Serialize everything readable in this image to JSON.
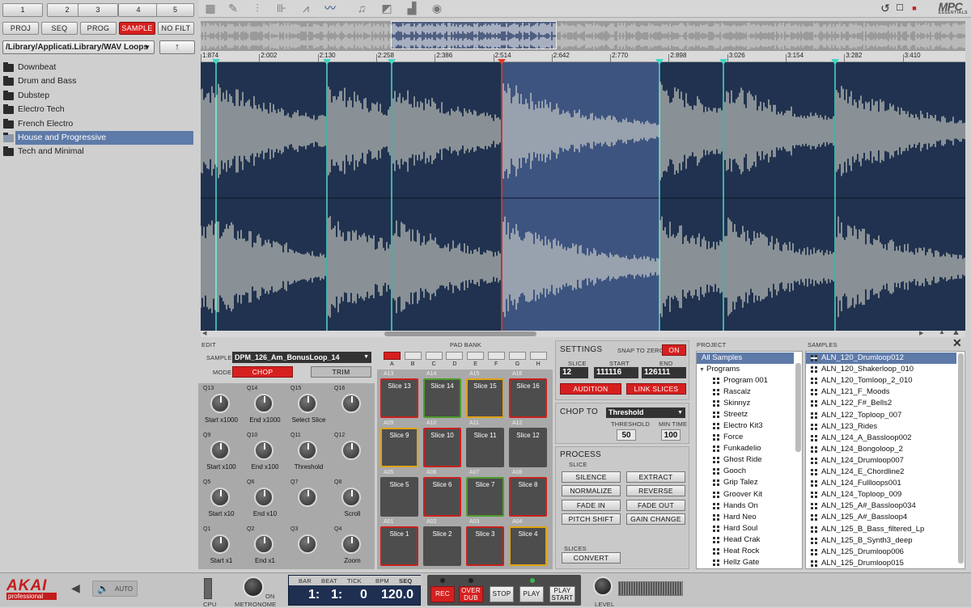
{
  "numbers": [
    "1",
    "2",
    "3",
    "4",
    "5"
  ],
  "modes": [
    {
      "label": "PROJ",
      "active": false
    },
    {
      "label": "SEQ",
      "active": false
    },
    {
      "label": "PROG",
      "active": false
    },
    {
      "label": "SAMPLE",
      "active": true
    },
    {
      "label": "NO FILT",
      "active": false
    }
  ],
  "path": "/Library/Applicati.Library/WAV Loops",
  "up_icon": "↑",
  "folders": [
    "Downbeat",
    "Drum and Bass",
    "Dubstep",
    "Electro Tech",
    "French Electro",
    "House and Progressive",
    "Tech and Minimal"
  ],
  "selected_folder": "House and Progressive",
  "logo": {
    "line1": "MPC",
    "line2": "ESSENTIALS"
  },
  "timeline": [
    "1:874",
    "2:002",
    "2:130",
    "2:258",
    "2:386",
    "2:514",
    "2:642",
    "2:770",
    "2:898",
    "3:026",
    "3:154",
    "3:282",
    "3:410"
  ],
  "edit": {
    "title": "EDIT",
    "sample_label": "SAMPLE",
    "sample_value": "DPM_126_Am_BonusLoop_14",
    "mode_label": "MODE",
    "chop": "CHOP",
    "trim": "TRIM",
    "qlinks": [
      {
        "q": "Q13",
        "label": "Start x1000"
      },
      {
        "q": "Q14",
        "label": "End x1000"
      },
      {
        "q": "Q15",
        "label": "Select Slice"
      },
      {
        "q": "Q16",
        "label": ""
      },
      {
        "q": "Q9",
        "label": "Start x100"
      },
      {
        "q": "Q10",
        "label": "End x100"
      },
      {
        "q": "Q11",
        "label": "Threshold"
      },
      {
        "q": "Q12",
        "label": ""
      },
      {
        "q": "Q5",
        "label": "Start x10"
      },
      {
        "q": "Q6",
        "label": "End x10"
      },
      {
        "q": "Q7",
        "label": ""
      },
      {
        "q": "Q8",
        "label": "Scroll"
      },
      {
        "q": "Q1",
        "label": "Start x1"
      },
      {
        "q": "Q2",
        "label": "End x1"
      },
      {
        "q": "Q3",
        "label": ""
      },
      {
        "q": "Q4",
        "label": "Zoom"
      }
    ]
  },
  "padbank": {
    "title": "PAD BANK",
    "banks": [
      "A",
      "B",
      "C",
      "D",
      "E",
      "F",
      "G",
      "H"
    ],
    "pads": [
      {
        "id": "A13",
        "name": "Slice 13",
        "color": "red"
      },
      {
        "id": "A14",
        "name": "Slice 14",
        "color": "grn"
      },
      {
        "id": "A15",
        "name": "Slice 15",
        "color": "yel"
      },
      {
        "id": "A16",
        "name": "Slice 16",
        "color": "red"
      },
      {
        "id": "A09",
        "name": "Slice 9",
        "color": "yel"
      },
      {
        "id": "A10",
        "name": "Slice 10",
        "color": "red"
      },
      {
        "id": "A11",
        "name": "Slice 11",
        "color": ""
      },
      {
        "id": "A12",
        "name": "Slice 12",
        "color": ""
      },
      {
        "id": "A05",
        "name": "Slice 5",
        "color": ""
      },
      {
        "id": "A06",
        "name": "Slice 6",
        "color": "red"
      },
      {
        "id": "A07",
        "name": "Slice 7",
        "color": "grn"
      },
      {
        "id": "A08",
        "name": "Slice 8",
        "color": "red"
      },
      {
        "id": "A01",
        "name": "Slice 1",
        "color": "red"
      },
      {
        "id": "A02",
        "name": "Slice 2",
        "color": ""
      },
      {
        "id": "A03",
        "name": "Slice 3",
        "color": "red"
      },
      {
        "id": "A04",
        "name": "Slice 4",
        "color": "yel"
      }
    ]
  },
  "settings": {
    "title": "SETTINGS",
    "snap_label": "SNAP TO ZERO",
    "snap_value": "ON",
    "slice_label": "SLICE",
    "slice": "12",
    "start_label": "START",
    "start": "111116",
    "end_label": "END",
    "end": "126111",
    "audition": "AUDITION",
    "link": "LINK SLICES"
  },
  "chop": {
    "title": "CHOP TO",
    "mode": "Threshold",
    "threshold_label": "THRESHOLD",
    "threshold": "50",
    "mintime_label": "MIN TIME",
    "mintime": "100"
  },
  "process": {
    "title": "PROCESS",
    "sub": "SLICE",
    "buttons": [
      "SILENCE",
      "EXTRACT",
      "NORMALIZE",
      "REVERSE",
      "FADE IN",
      "FADE OUT",
      "PITCH SHIFT",
      "GAIN CHANGE"
    ],
    "slices_label": "SLICES",
    "convert": "CONVERT"
  },
  "project": {
    "title": "PROJECT",
    "all": "All Samples",
    "programs_label": "Programs",
    "programs": [
      "Program 001",
      "Rascalz",
      "Skinnyz",
      "Streetz",
      "Electro Kit3",
      "Force",
      "Funkadelio",
      "Ghost Ride",
      "Gooch",
      "Grip Talez",
      "Groover Kit",
      "Hands On",
      "Hard Neo",
      "Hard Soul",
      "Head Crak",
      "Heat Rock",
      "Hellz Gate"
    ]
  },
  "samples": {
    "title": "SAMPLES",
    "close": "✕",
    "items": [
      "ALN_120_Drumloop012",
      "ALN_120_Shakerloop_010",
      "ALN_120_Tomloop_2_010",
      "ALN_121_F_Moods",
      "ALN_122_F#_Bells2",
      "ALN_122_Toploop_007",
      "ALN_123_Rides",
      "ALN_124_A_Bassloop002",
      "ALN_124_Bongoloop_2",
      "ALN_124_Drumloop007",
      "ALN_124_E_Chordline2",
      "ALN_124_Fullloops001",
      "ALN_124_Toploop_009",
      "ALN_125_A#_Bassloop034",
      "ALN_125_A#_Bassloop4",
      "ALN_125_B_Bass_filtered_Lp",
      "ALN_125_B_Synth3_deep",
      "ALN_125_Drumloop006",
      "ALN_125_Drumloop015"
    ]
  },
  "transport": {
    "brand": "AKAI",
    "brand_sub": "professional",
    "auto": "AUTO",
    "cpu": "CPU",
    "metronome": "METRONOME",
    "on": "ON",
    "headers": [
      "BAR",
      "BEAT",
      "TICK",
      "BPM",
      "SEQ"
    ],
    "bar": "1:",
    "beat": "1:",
    "tick": "0",
    "bpm": "120.0",
    "rec": "REC",
    "overdub": "OVER\nDUB",
    "stop": "STOP",
    "play": "PLAY",
    "playstart": "PLAY\nSTART",
    "level": "LEVEL"
  }
}
